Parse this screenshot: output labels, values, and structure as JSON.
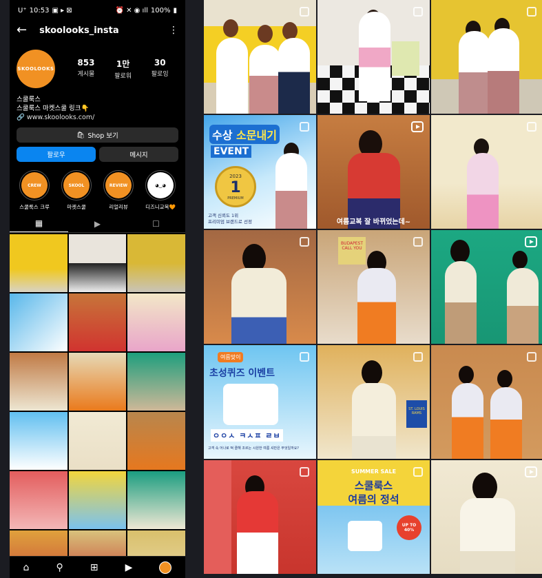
{
  "status_bar": {
    "carrier": "U⁺",
    "time": "10:53",
    "battery": "100%"
  },
  "header": {
    "username": "skoolooks_insta"
  },
  "profile": {
    "avatar_text": "SKOOLOOKS",
    "stats": [
      {
        "num": "853",
        "label": "게시물"
      },
      {
        "num": "1만",
        "label": "팔로워"
      },
      {
        "num": "30",
        "label": "팔로잉"
      }
    ],
    "name": "스쿨룩스",
    "bio_line": "스쿨룩스 마켓스쿨 링크👇",
    "website": "www.skoolooks.com/"
  },
  "buttons": {
    "shop": "Shop 보기",
    "follow": "팔로우",
    "message": "메시지"
  },
  "highlights": [
    {
      "label": "스쿨룩스 크루",
      "badge": "CREW"
    },
    {
      "label": "마켓스쿨",
      "badge": "SKOOL"
    },
    {
      "label": "리얼리뷰",
      "badge": "REVIEW"
    },
    {
      "label": "디즈니교복🧡",
      "badge": ""
    }
  ],
  "big_grid": {
    "event1": {
      "banner": "소문내기",
      "pre": "수상",
      "event": "EVENT",
      "year": "2023",
      "rank": "1",
      "badge": "PREMIUM",
      "line1": "고객 신뢰도 1위",
      "line2": "프리미엄 브랜드로 선정"
    },
    "caption_summer": "여름교복 잘 바뀌었는데~",
    "event2": {
      "title1": "여름맞이",
      "title2": "초성퀴즈 이벤트",
      "answer": "ㅇㅇㅅ ㅋㅅㅍ ㄹㅂ",
      "note": "고객 속 어나로 떡 클해 조르는 시원한 여름 셔만은 무엇일까요?"
    },
    "sale": {
      "tag": "SUMMER SALE",
      "title1": "스쿨룩스",
      "title2": "여름의 정석",
      "off": "UP TO 40%"
    },
    "poster1": "BUDAPEST CALL YOU",
    "poster2": "ST. LOUIS RAMS"
  },
  "colors": {
    "brand_orange": "#f19123",
    "follow_blue": "#0a85f0"
  }
}
